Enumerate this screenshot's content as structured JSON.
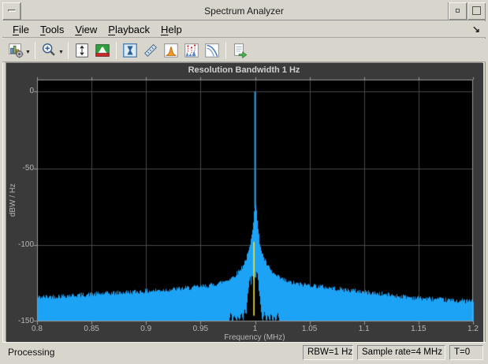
{
  "window": {
    "title": "Spectrum Analyzer"
  },
  "menubar": {
    "items": [
      "File",
      "Tools",
      "View",
      "Playback",
      "Help"
    ]
  },
  "toolbar": {
    "buttons": [
      {
        "name": "scope-settings",
        "icon": "bar-chart-gear-icon",
        "has_dropdown": true
      },
      {
        "name": "zoom-in",
        "icon": "magnifier-plus-icon",
        "has_dropdown": true
      },
      {
        "name": "autoscale-axes",
        "icon": "box-updown-arrows-icon",
        "has_dropdown": false
      },
      {
        "name": "spectrum-settings",
        "icon": "green-red-spectrum-icon",
        "has_dropdown": false
      },
      {
        "name": "cursor-measurements",
        "icon": "hourglass-cursors-icon",
        "has_dropdown": false
      },
      {
        "name": "signal-statistics",
        "icon": "ruler-icon",
        "has_dropdown": false
      },
      {
        "name": "peak-finder",
        "icon": "orange-peak-icon",
        "has_dropdown": false
      },
      {
        "name": "distortion-measurements",
        "icon": "spectrum-markers-icon",
        "has_dropdown": false
      },
      {
        "name": "ccdf-measurements",
        "icon": "ccdf-curves-icon",
        "has_dropdown": false
      },
      {
        "name": "export-playback",
        "icon": "document-green-arrow-icon",
        "has_dropdown": false
      }
    ]
  },
  "figure": {
    "title": "Resolution Bandwidth 1 Hz"
  },
  "chart_data": {
    "type": "area",
    "title": "Resolution Bandwidth 1 Hz",
    "xlabel": "Frequency (MHz)",
    "ylabel": "dBW / Hz",
    "xlim": [
      0.8,
      1.2
    ],
    "ylim": [
      -150,
      7.7
    ],
    "xticks": [
      0.8,
      0.85,
      0.9,
      0.95,
      1,
      1.05,
      1.1,
      1.15,
      1.2
    ],
    "xtick_labels": [
      "0.8",
      "0.85",
      "0.9",
      "0.95",
      "1",
      "1.05",
      "1.1",
      "1.15",
      "1.2"
    ],
    "yticks": [
      0,
      -50,
      -100,
      -150
    ],
    "ytick_labels": [
      "0",
      "-50",
      "-100",
      "-150"
    ],
    "grid": true,
    "plot_background": "#000000",
    "figure_background": "#3a3a3a",
    "grid_color": "#4a4a4a",
    "frame_color": "#9a9a9a",
    "series": [
      {
        "name": "spectrum-trace",
        "color": "#1ca3f5",
        "style": "filled",
        "noise_dB": 3,
        "spike": {
          "x": 1.0,
          "top_dB": 0
        },
        "envelope_dB": [
          [
            0.8,
            -134
          ],
          [
            0.85,
            -132
          ],
          [
            0.9,
            -130
          ],
          [
            0.93,
            -128.5
          ],
          [
            0.95,
            -127
          ],
          [
            0.96,
            -126
          ],
          [
            0.97,
            -124
          ],
          [
            0.975,
            -122.5
          ],
          [
            0.98,
            -120.5
          ],
          [
            0.985,
            -117
          ],
          [
            0.988,
            -114
          ],
          [
            0.991,
            -110
          ],
          [
            0.993,
            -106
          ],
          [
            0.995,
            -101
          ],
          [
            0.996,
            -97
          ],
          [
            0.997,
            -92
          ],
          [
            0.998,
            -86
          ],
          [
            0.9985,
            -81
          ],
          [
            0.999,
            -76
          ],
          [
            0.9995,
            -73
          ],
          [
            1.0,
            -72
          ],
          [
            1.0005,
            -74
          ],
          [
            1.001,
            -77
          ],
          [
            1.0015,
            -82
          ],
          [
            1.002,
            -86
          ],
          [
            1.003,
            -93
          ],
          [
            1.004,
            -98
          ],
          [
            1.005,
            -102
          ],
          [
            1.007,
            -107
          ],
          [
            1.01,
            -112
          ],
          [
            1.015,
            -117.5
          ],
          [
            1.02,
            -120.5
          ],
          [
            1.03,
            -124
          ],
          [
            1.04,
            -125.5
          ],
          [
            1.05,
            -126
          ],
          [
            1.07,
            -128
          ],
          [
            1.1,
            -130.5
          ],
          [
            1.13,
            -133
          ],
          [
            1.15,
            -134.5
          ],
          [
            1.18,
            -136
          ],
          [
            1.2,
            -136.5
          ]
        ]
      },
      {
        "name": "inner-black-trace",
        "color": "#000000",
        "style": "filled",
        "noise_dB": 1.5,
        "envelope_dB": [
          [
            0.976,
            -150
          ],
          [
            0.9775,
            -144
          ],
          [
            0.979,
            -150
          ],
          [
            0.981,
            -145
          ],
          [
            0.9825,
            -150
          ],
          [
            0.984,
            -146
          ],
          [
            0.9855,
            -150
          ],
          [
            0.987,
            -143
          ],
          [
            0.9885,
            -150
          ],
          [
            0.99,
            -141
          ],
          [
            0.9915,
            -147
          ],
          [
            0.9925,
            -136
          ],
          [
            0.9935,
            -129
          ],
          [
            0.9945,
            -124
          ],
          [
            0.995,
            -119
          ],
          [
            0.9955,
            -122
          ],
          [
            0.996,
            -126
          ],
          [
            0.9965,
            -121
          ],
          [
            0.997,
            -118
          ],
          [
            0.9975,
            -121
          ],
          [
            0.998,
            -124
          ],
          [
            0.9985,
            -120
          ],
          [
            0.999,
            -117
          ],
          [
            0.9995,
            -120
          ],
          [
            1.0,
            -125
          ],
          [
            1.0005,
            -119
          ],
          [
            1.001,
            -116.5
          ],
          [
            1.0015,
            -120
          ],
          [
            1.002,
            -118
          ],
          [
            1.0025,
            -123
          ],
          [
            1.003,
            -128
          ],
          [
            1.004,
            -134
          ],
          [
            1.005,
            -141
          ],
          [
            1.006,
            -147
          ],
          [
            1.007,
            -150
          ],
          [
            1.0085,
            -143
          ],
          [
            1.01,
            -150
          ],
          [
            1.0115,
            -145
          ],
          [
            1.013,
            -150
          ],
          [
            1.0145,
            -144
          ],
          [
            1.016,
            -150
          ],
          [
            1.0175,
            -146
          ],
          [
            1.019,
            -150
          ],
          [
            1.0205,
            -144
          ],
          [
            1.022,
            -150
          ]
        ]
      },
      {
        "name": "yellow-marker-line",
        "color": "#f0e437",
        "style": "vline",
        "x": 0.999,
        "top_dB": -98,
        "bottom_dB": -146
      }
    ]
  },
  "statusbar": {
    "status": "Processing",
    "panels": [
      "RBW=1 Hz",
      "Sample rate=4 MHz",
      "T=0"
    ]
  }
}
